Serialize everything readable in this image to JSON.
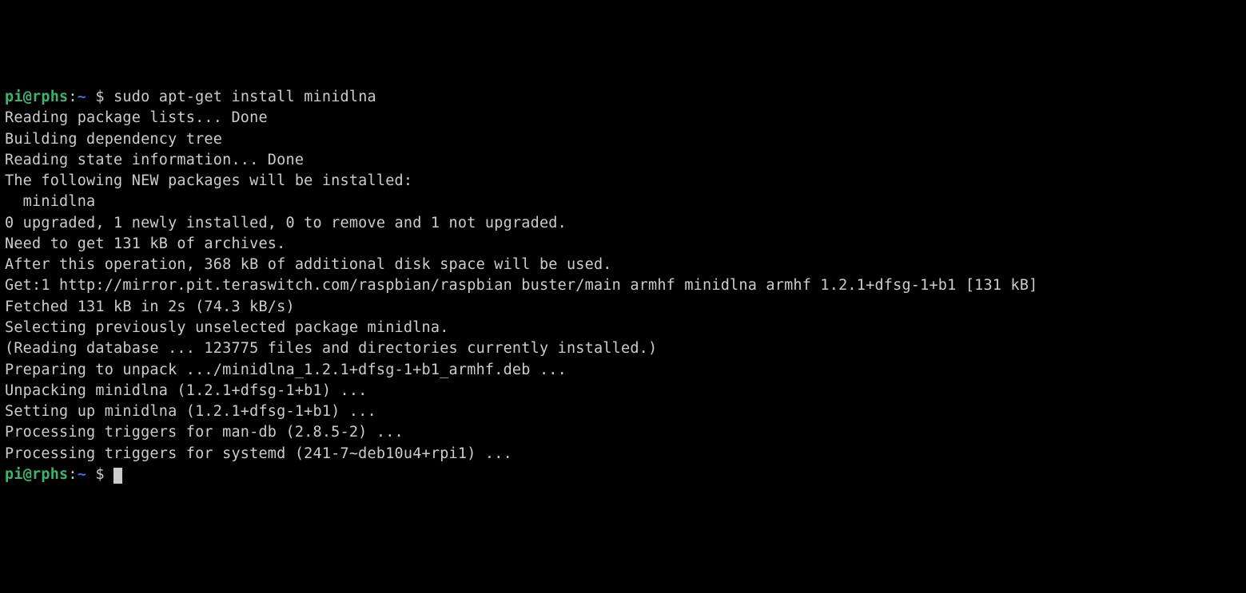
{
  "prompt1": {
    "user": "pi",
    "at": "@",
    "host": "rphs",
    "colon": ":",
    "path": "~",
    "dollar": " $ ",
    "command": "sudo apt-get install minidlna"
  },
  "lines": {
    "l0": "Reading package lists... Done",
    "l1": "Building dependency tree",
    "l2": "Reading state information... Done",
    "l3": "The following NEW packages will be installed:",
    "l4": "  minidlna",
    "l5": "0 upgraded, 1 newly installed, 0 to remove and 1 not upgraded.",
    "l6": "Need to get 131 kB of archives.",
    "l7": "After this operation, 368 kB of additional disk space will be used.",
    "l8": "Get:1 http://mirror.pit.teraswitch.com/raspbian/raspbian buster/main armhf minidlna armhf 1.2.1+dfsg-1+b1 [131 kB]",
    "l9": "Fetched 131 kB in 2s (74.3 kB/s)",
    "l10": "Selecting previously unselected package minidlna.",
    "l11": "(Reading database ... 123775 files and directories currently installed.)",
    "l12": "Preparing to unpack .../minidlna_1.2.1+dfsg-1+b1_armhf.deb ...",
    "l13": "Unpacking minidlna (1.2.1+dfsg-1+b1) ...",
    "l14": "Setting up minidlna (1.2.1+dfsg-1+b1) ...",
    "l15": "Processing triggers for man-db (2.8.5-2) ...",
    "l16": "Processing triggers for systemd (241-7~deb10u4+rpi1) ..."
  },
  "prompt2": {
    "user": "pi",
    "at": "@",
    "host": "rphs",
    "colon": ":",
    "path": "~",
    "dollar": " $ "
  }
}
